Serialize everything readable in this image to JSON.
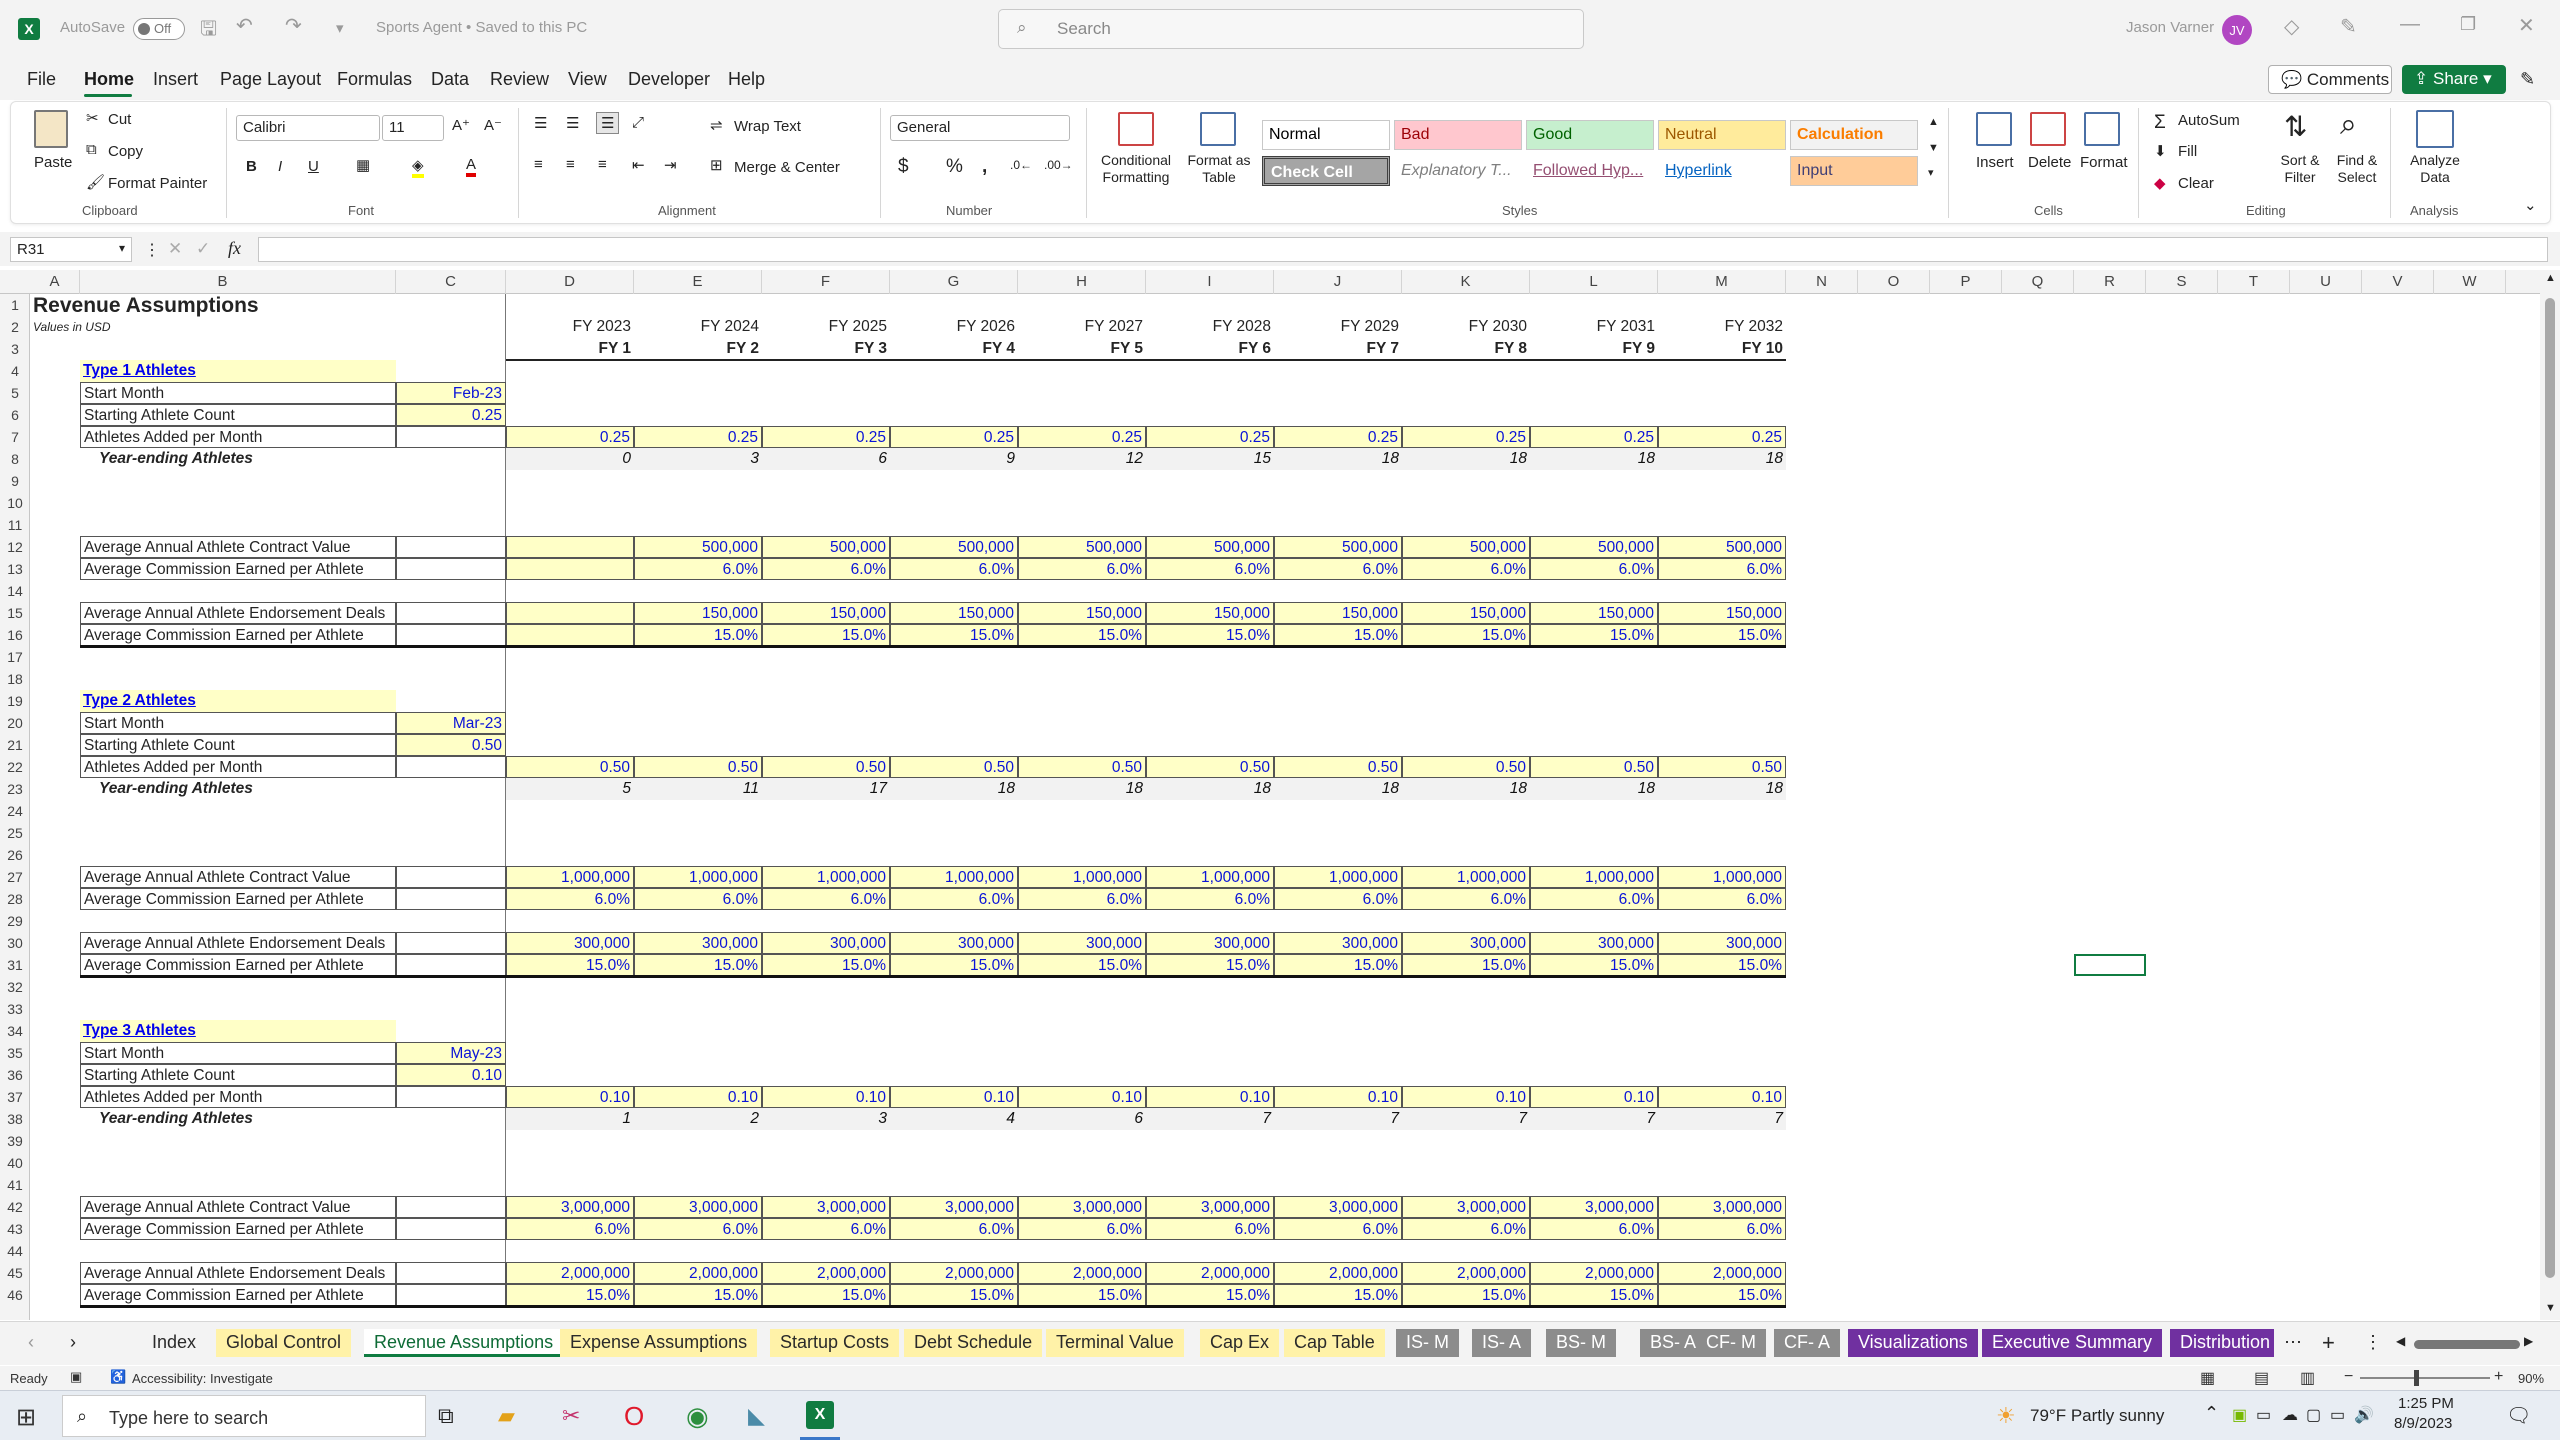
{
  "window": {
    "autosave_label": "AutoSave",
    "autosave_state": "Off",
    "title": "Sports Agent • Saved to this PC",
    "search_placeholder": "Search",
    "user_name": "Jason Varner",
    "user_initials": "JV"
  },
  "menu": [
    "File",
    "Home",
    "Insert",
    "Page Layout",
    "Formulas",
    "Data",
    "Review",
    "View",
    "Developer",
    "Help"
  ],
  "menu_actions": {
    "comments": "Comments",
    "share": "Share"
  },
  "ribbon": {
    "clipboard": {
      "paste": "Paste",
      "cut": "Cut",
      "copy": "Copy",
      "format_painter": "Format Painter",
      "group": "Clipboard"
    },
    "font": {
      "name": "Calibri",
      "size": "11",
      "group": "Font"
    },
    "alignment": {
      "wrap_text": "Wrap Text",
      "merge_center": "Merge & Center",
      "group": "Alignment"
    },
    "number": {
      "format": "General",
      "group": "Number"
    },
    "styles": {
      "conditional": "Conditional Formatting",
      "format_table": "Format as Table",
      "cells": [
        {
          "label": "Normal",
          "bg": "#ffffff",
          "fg": "#000000"
        },
        {
          "label": "Bad",
          "bg": "#ffc7ce",
          "fg": "#9c0006"
        },
        {
          "label": "Good",
          "bg": "#c6efce",
          "fg": "#006100"
        },
        {
          "label": "Neutral",
          "bg": "#ffeb9c",
          "fg": "#9c5700"
        },
        {
          "label": "Calculation",
          "bg": "#f2f2f2",
          "fg": "#fa7d00"
        },
        {
          "label": "Check Cell",
          "bg": "#a5a5a5",
          "fg": "#ffffff"
        },
        {
          "label": "Explanatory T...",
          "bg": "#ffffff",
          "fg": "#7f7f7f"
        },
        {
          "label": "Followed Hyp...",
          "bg": "#ffffff",
          "fg": "#954f72"
        },
        {
          "label": "Hyperlink",
          "bg": "#ffffff",
          "fg": "#0563c1"
        },
        {
          "label": "Input",
          "bg": "#ffcc99",
          "fg": "#3f3f76"
        }
      ],
      "group": "Styles"
    },
    "cells": {
      "insert": "Insert",
      "delete": "Delete",
      "format": "Format",
      "group": "Cells"
    },
    "editing": {
      "autosum": "AutoSum",
      "fill": "Fill",
      "clear": "Clear",
      "sort_filter": "Sort & Filter",
      "find_select": "Find & Select",
      "group": "Editing"
    },
    "analysis": {
      "analyze": "Analyze Data",
      "group": "Analysis"
    }
  },
  "formula_bar": {
    "name_box": "R31",
    "fx": "fx",
    "formula": ""
  },
  "columns": [
    "A",
    "B",
    "C",
    "D",
    "E",
    "F",
    "G",
    "H",
    "I",
    "J",
    "K",
    "L",
    "M",
    "N",
    "O",
    "P",
    "Q",
    "R",
    "S",
    "T",
    "U",
    "V",
    "W"
  ],
  "sheet": {
    "title": "Revenue Assumptions",
    "subtitle": "Values in USD",
    "fy_years": [
      "FY 2023",
      "FY 2024",
      "FY 2025",
      "FY 2026",
      "FY 2027",
      "FY 2028",
      "FY 2029",
      "FY 2030",
      "FY 2031",
      "FY 2032"
    ],
    "fy_labels": [
      "FY 1",
      "FY 2",
      "FY 3",
      "FY 4",
      "FY 5",
      "FY 6",
      "FY 7",
      "FY 8",
      "FY 9",
      "FY 10"
    ],
    "sections": [
      {
        "title": "Type 1 Athletes",
        "start_month_label": "Start Month",
        "start_month": "Feb-23",
        "starting_count_label": "Starting Athlete Count",
        "starting_count": "0.25",
        "added_label": "Athletes Added per Month",
        "added": [
          "0.25",
          "0.25",
          "0.25",
          "0.25",
          "0.25",
          "0.25",
          "0.25",
          "0.25",
          "0.25",
          "0.25"
        ],
        "year_end_label": "Year-ending Athletes",
        "year_end": [
          "0",
          "3",
          "6",
          "9",
          "12",
          "15",
          "18",
          "18",
          "18",
          "18"
        ],
        "contract_label": "Average Annual Athlete Contract Value",
        "contract": [
          "",
          "500,000",
          "500,000",
          "500,000",
          "500,000",
          "500,000",
          "500,000",
          "500,000",
          "500,000",
          "500,000"
        ],
        "commission1_label": "Average Commission Earned per Athlete",
        "commission1": [
          "",
          "6.0%",
          "6.0%",
          "6.0%",
          "6.0%",
          "6.0%",
          "6.0%",
          "6.0%",
          "6.0%",
          "6.0%"
        ],
        "endorse_label": "Average Annual Athlete Endorsement Deals",
        "endorse": [
          "",
          "150,000",
          "150,000",
          "150,000",
          "150,000",
          "150,000",
          "150,000",
          "150,000",
          "150,000",
          "150,000"
        ],
        "commission2_label": "Average Commission Earned per Athlete",
        "commission2": [
          "",
          "15.0%",
          "15.0%",
          "15.0%",
          "15.0%",
          "15.0%",
          "15.0%",
          "15.0%",
          "15.0%",
          "15.0%"
        ]
      },
      {
        "title": "Type 2 Athletes",
        "start_month_label": "Start Month",
        "start_month": "Mar-23",
        "starting_count_label": "Starting Athlete Count",
        "starting_count": "0.50",
        "added_label": "Athletes Added per Month",
        "added": [
          "0.50",
          "0.50",
          "0.50",
          "0.50",
          "0.50",
          "0.50",
          "0.50",
          "0.50",
          "0.50",
          "0.50"
        ],
        "year_end_label": "Year-ending Athletes",
        "year_end": [
          "5",
          "11",
          "17",
          "18",
          "18",
          "18",
          "18",
          "18",
          "18",
          "18"
        ],
        "contract_label": "Average Annual Athlete Contract Value",
        "contract": [
          "1,000,000",
          "1,000,000",
          "1,000,000",
          "1,000,000",
          "1,000,000",
          "1,000,000",
          "1,000,000",
          "1,000,000",
          "1,000,000",
          "1,000,000"
        ],
        "commission1_label": "Average Commission Earned per Athlete",
        "commission1": [
          "6.0%",
          "6.0%",
          "6.0%",
          "6.0%",
          "6.0%",
          "6.0%",
          "6.0%",
          "6.0%",
          "6.0%",
          "6.0%"
        ],
        "endorse_label": "Average Annual Athlete Endorsement Deals",
        "endorse": [
          "300,000",
          "300,000",
          "300,000",
          "300,000",
          "300,000",
          "300,000",
          "300,000",
          "300,000",
          "300,000",
          "300,000"
        ],
        "commission2_label": "Average Commission Earned per Athlete",
        "commission2": [
          "15.0%",
          "15.0%",
          "15.0%",
          "15.0%",
          "15.0%",
          "15.0%",
          "15.0%",
          "15.0%",
          "15.0%",
          "15.0%"
        ]
      },
      {
        "title": "Type 3 Athletes",
        "start_month_label": "Start Month",
        "start_month": "May-23",
        "starting_count_label": "Starting Athlete Count",
        "starting_count": "0.10",
        "added_label": "Athletes Added per Month",
        "added": [
          "0.10",
          "0.10",
          "0.10",
          "0.10",
          "0.10",
          "0.10",
          "0.10",
          "0.10",
          "0.10",
          "0.10"
        ],
        "year_end_label": "Year-ending Athletes",
        "year_end": [
          "1",
          "2",
          "3",
          "4",
          "6",
          "7",
          "7",
          "7",
          "7",
          "7"
        ],
        "contract_label": "Average Annual Athlete Contract Value",
        "contract": [
          "3,000,000",
          "3,000,000",
          "3,000,000",
          "3,000,000",
          "3,000,000",
          "3,000,000",
          "3,000,000",
          "3,000,000",
          "3,000,000",
          "3,000,000"
        ],
        "commission1_label": "Average Commission Earned per Athlete",
        "commission1": [
          "6.0%",
          "6.0%",
          "6.0%",
          "6.0%",
          "6.0%",
          "6.0%",
          "6.0%",
          "6.0%",
          "6.0%",
          "6.0%"
        ],
        "endorse_label": "Average Annual Athlete Endorsement Deals",
        "endorse": [
          "2,000,000",
          "2,000,000",
          "2,000,000",
          "2,000,000",
          "2,000,000",
          "2,000,000",
          "2,000,000",
          "2,000,000",
          "2,000,000",
          "2,000,000"
        ],
        "commission2_label": "Average Commission Earned per Athlete",
        "commission2": [
          "15.0%",
          "15.0%",
          "15.0%",
          "15.0%",
          "15.0%",
          "15.0%",
          "15.0%",
          "15.0%",
          "15.0%",
          "15.0%"
        ]
      }
    ]
  },
  "tabs": [
    {
      "label": "Index",
      "color": ""
    },
    {
      "label": "Global Control",
      "color": "#fff2a8"
    },
    {
      "label": "Revenue Assumptions",
      "color": "active"
    },
    {
      "label": "Expense Assumptions",
      "color": "#fff2a8"
    },
    {
      "label": "Startup Costs",
      "color": "#fff2a8"
    },
    {
      "label": "Debt Schedule",
      "color": "#fff2a8"
    },
    {
      "label": "Terminal Value",
      "color": "#fff2a8"
    },
    {
      "label": "Cap Ex",
      "color": "#fff2a8"
    },
    {
      "label": "Cap Table",
      "color": "#fff2a8"
    },
    {
      "label": "IS- M",
      "color": "#8c8c8c"
    },
    {
      "label": "IS- A",
      "color": "#8c8c8c"
    },
    {
      "label": "BS- M",
      "color": "#8c8c8c"
    },
    {
      "label": "BS- A",
      "color": "#8c8c8c"
    },
    {
      "label": "CF- M",
      "color": "#8c8c8c"
    },
    {
      "label": "CF- A",
      "color": "#8c8c8c"
    },
    {
      "label": "Visualizations",
      "color": "#7030a0"
    },
    {
      "label": "Executive Summary",
      "color": "#7030a0"
    },
    {
      "label": "Distribution",
      "color": "#7030a0"
    }
  ],
  "status": {
    "ready": "Ready",
    "accessibility": "Accessibility: Investigate",
    "zoom": "90%"
  },
  "taskbar": {
    "search_placeholder": "Type here to search",
    "weather": "79°F  Partly sunny",
    "time": "1:25 PM",
    "date": "8/9/2023"
  }
}
